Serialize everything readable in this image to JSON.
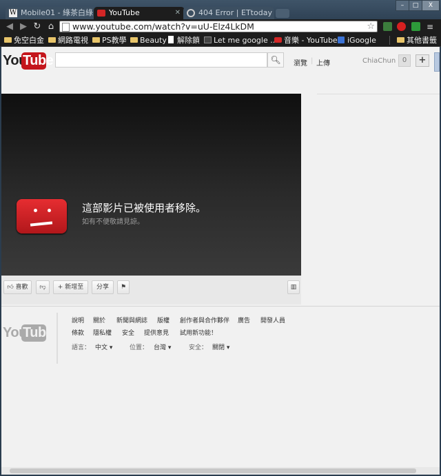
{
  "window": {
    "minimize": "–",
    "maximize": "□",
    "close": "X"
  },
  "tabs": [
    {
      "title": "Mobile01 - 綠茶白綠"
    },
    {
      "title": "YouTube"
    },
    {
      "title": "404 Error | ETtoday"
    }
  ],
  "address": {
    "url": "www.youtube.com/watch?v=uU-Elz4LkDM"
  },
  "bookmarks": [
    {
      "label": "免空白金"
    },
    {
      "label": "網路電視"
    },
    {
      "label": "PS教學"
    },
    {
      "label": "Beauty"
    },
    {
      "label": "解除鎖"
    },
    {
      "label": "Let me google ..."
    },
    {
      "label": "音樂 - YouTube"
    },
    {
      "label": "iGoogle"
    },
    {
      "label": "其他書籤"
    }
  ],
  "header": {
    "logo_you": "You",
    "logo_tube": "Tube",
    "browse": "瀏覽",
    "upload": "上傳",
    "user": "ChiaChun Li",
    "notifications": "0",
    "plus": "+"
  },
  "player": {
    "message": "這部影片已被使用者移除。",
    "sub": "如有不便敬請見諒。"
  },
  "actions": {
    "like": "喜歡",
    "add_to": "新增至",
    "share": "分享"
  },
  "footer": {
    "logo_you": "You",
    "logo_tube": "Tube",
    "links_row1": [
      "說明",
      "關於",
      "新聞與網誌",
      "版權",
      "創作者與合作夥伴",
      "廣告",
      "開發人員"
    ],
    "links_row2": [
      "條款",
      "隱私權",
      "安全",
      "提供意見",
      "試用新功能！"
    ],
    "language_label": "語言：",
    "language_value": "中文",
    "location_label": "位置：",
    "location_value": "台灣",
    "safety_label": "安全：",
    "safety_value": "關閉"
  },
  "colors": {
    "brand_red": "#c4161c",
    "chrome_frame": "#2b3d4f",
    "page_bg": "#f1f1f1"
  }
}
